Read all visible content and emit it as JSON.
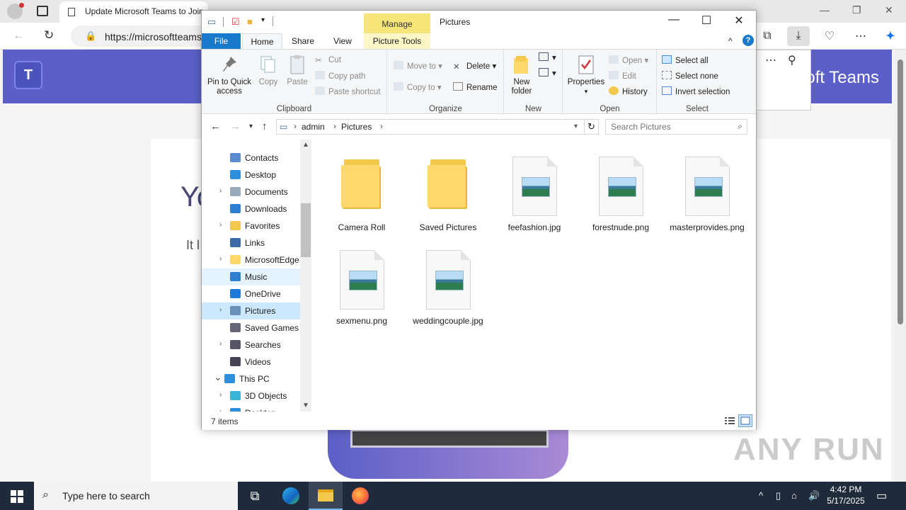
{
  "browser": {
    "tab_title": "Update Microsoft Teams to Join",
    "url": "https://microsoftteams",
    "window_controls": {
      "minimize": "—",
      "restore": "❐",
      "close": "✕"
    }
  },
  "teams_page": {
    "brand": "oft Teams",
    "heading_partial": "Yo",
    "subtext_partial": "It l"
  },
  "explorer": {
    "title": "Pictures",
    "contextual_tab": "Manage",
    "tabs": [
      "File",
      "Home",
      "Share",
      "View",
      "Picture Tools"
    ],
    "ribbon": {
      "clipboard": {
        "label": "Clipboard",
        "pin": "Pin to Quick\naccess",
        "copy": "Copy",
        "paste": "Paste",
        "cut": "Cut",
        "copy_path": "Copy path",
        "paste_shortcut": "Paste shortcut"
      },
      "organize": {
        "label": "Organize",
        "move_to": "Move to",
        "copy_to": "Copy to",
        "delete": "Delete",
        "rename": "Rename"
      },
      "new": {
        "label": "New",
        "new_folder": "New\nfolder"
      },
      "open": {
        "label": "Open",
        "properties": "Properties",
        "open": "Open",
        "edit": "Edit",
        "history": "History"
      },
      "select": {
        "label": "Select",
        "select_all": "Select all",
        "select_none": "Select none",
        "invert_selection": "Invert selection"
      }
    },
    "address": {
      "crumbs": [
        "admin",
        "Pictures"
      ],
      "search_placeholder": "Search Pictures"
    },
    "nav_items": [
      {
        "label": "Contacts",
        "icon": "contacts-icon",
        "expandable": false,
        "state": ""
      },
      {
        "label": "Desktop",
        "icon": "desktop-icon",
        "expandable": false,
        "state": ""
      },
      {
        "label": "Documents",
        "icon": "documents-icon",
        "expandable": true,
        "state": ""
      },
      {
        "label": "Downloads",
        "icon": "downloads-icon",
        "expandable": false,
        "state": ""
      },
      {
        "label": "Favorites",
        "icon": "favorites-icon",
        "expandable": true,
        "state": ""
      },
      {
        "label": "Links",
        "icon": "links-icon",
        "expandable": false,
        "state": ""
      },
      {
        "label": "MicrosoftEdge",
        "icon": "folder-icon",
        "expandable": true,
        "state": ""
      },
      {
        "label": "Music",
        "icon": "music-icon",
        "expandable": false,
        "state": "hover"
      },
      {
        "label": "OneDrive",
        "icon": "onedrive-icon",
        "expandable": false,
        "state": ""
      },
      {
        "label": "Pictures",
        "icon": "pictures-icon",
        "expandable": true,
        "state": "selected"
      },
      {
        "label": "Saved Games",
        "icon": "saved-games-icon",
        "expandable": false,
        "state": ""
      },
      {
        "label": "Searches",
        "icon": "searches-icon",
        "expandable": true,
        "state": ""
      },
      {
        "label": "Videos",
        "icon": "videos-icon",
        "expandable": false,
        "state": ""
      },
      {
        "label": "This PC",
        "icon": "this-pc-icon",
        "expandable": true,
        "state": "expanded"
      },
      {
        "label": "3D Objects",
        "icon": "3d-objects-icon",
        "expandable": true,
        "state": ""
      },
      {
        "label": "Desktop",
        "icon": "desktop-icon",
        "expandable": true,
        "state": ""
      }
    ],
    "files": [
      {
        "name": "Camera Roll",
        "type": "folder"
      },
      {
        "name": "Saved Pictures",
        "type": "folder"
      },
      {
        "name": "feefashion.jpg",
        "type": "image"
      },
      {
        "name": "forestnude.png",
        "type": "image"
      },
      {
        "name": "masterprovides.png",
        "type": "image"
      },
      {
        "name": "sexmenu.png",
        "type": "image"
      },
      {
        "name": "weddingcouple.jpg",
        "type": "image"
      }
    ],
    "status": "7 items"
  },
  "taskbar": {
    "search_placeholder": "Type here to search",
    "time": "4:42 PM",
    "date": "5/17/2025"
  },
  "watermark": "ANY RUN",
  "colors": {
    "accent": "#1979ca",
    "teams": "#5b5fc7",
    "manage_tab": "#f6e67a"
  }
}
